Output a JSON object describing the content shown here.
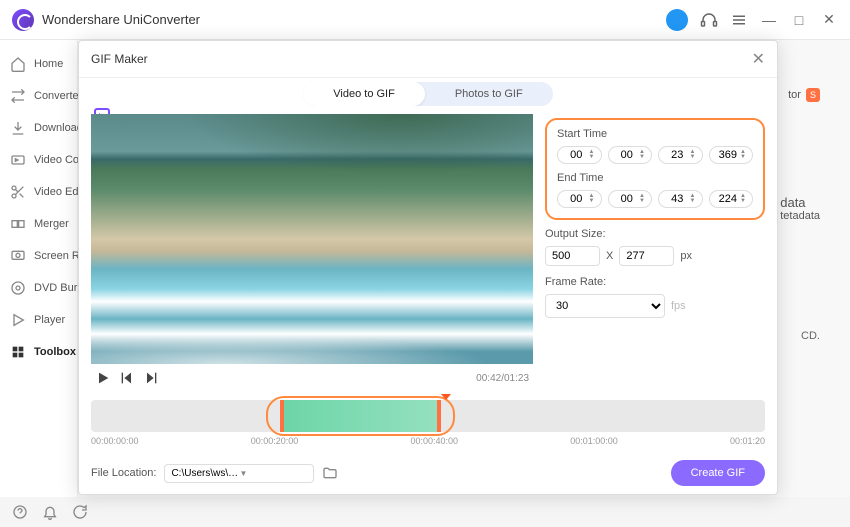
{
  "app": {
    "title": "Wondershare UniConverter"
  },
  "sidebar": {
    "items": [
      {
        "label": "Home"
      },
      {
        "label": "Converter"
      },
      {
        "label": "Downloader"
      },
      {
        "label": "Video Compressor"
      },
      {
        "label": "Video Editor"
      },
      {
        "label": "Merger"
      },
      {
        "label": "Screen Recorder"
      },
      {
        "label": "DVD Burner"
      },
      {
        "label": "Player"
      },
      {
        "label": "Toolbox"
      }
    ]
  },
  "background": {
    "tor_suffix": "tor",
    "badge": "S",
    "data_label": "data",
    "tetadata": "tetadata",
    "cd": "CD."
  },
  "gif": {
    "title": "GIF Maker",
    "tabs": {
      "video": "Video to GIF",
      "photos": "Photos to GIF"
    },
    "time": {
      "start_label": "Start Time",
      "end_label": "End Time",
      "start": {
        "h": "00",
        "m": "00",
        "s": "23",
        "ms": "369"
      },
      "end": {
        "h": "00",
        "m": "00",
        "s": "43",
        "ms": "224"
      }
    },
    "output": {
      "label": "Output Size:",
      "w": "500",
      "x": "X",
      "h": "277",
      "unit": "px"
    },
    "fps": {
      "label": "Frame Rate:",
      "value": "30",
      "unit": "fps"
    },
    "timecode": "00:42/01:23",
    "ruler": {
      "t0": "00:00:00:00",
      "t1": "00:00:20:00",
      "t2": "00:00:40:00",
      "t3": "00:01:00:00",
      "t4": "00:01:20"
    },
    "file": {
      "label": "File Location:",
      "path": "C:\\Users\\ws\\Pictures\\Wonders"
    },
    "create": "Create GIF"
  }
}
